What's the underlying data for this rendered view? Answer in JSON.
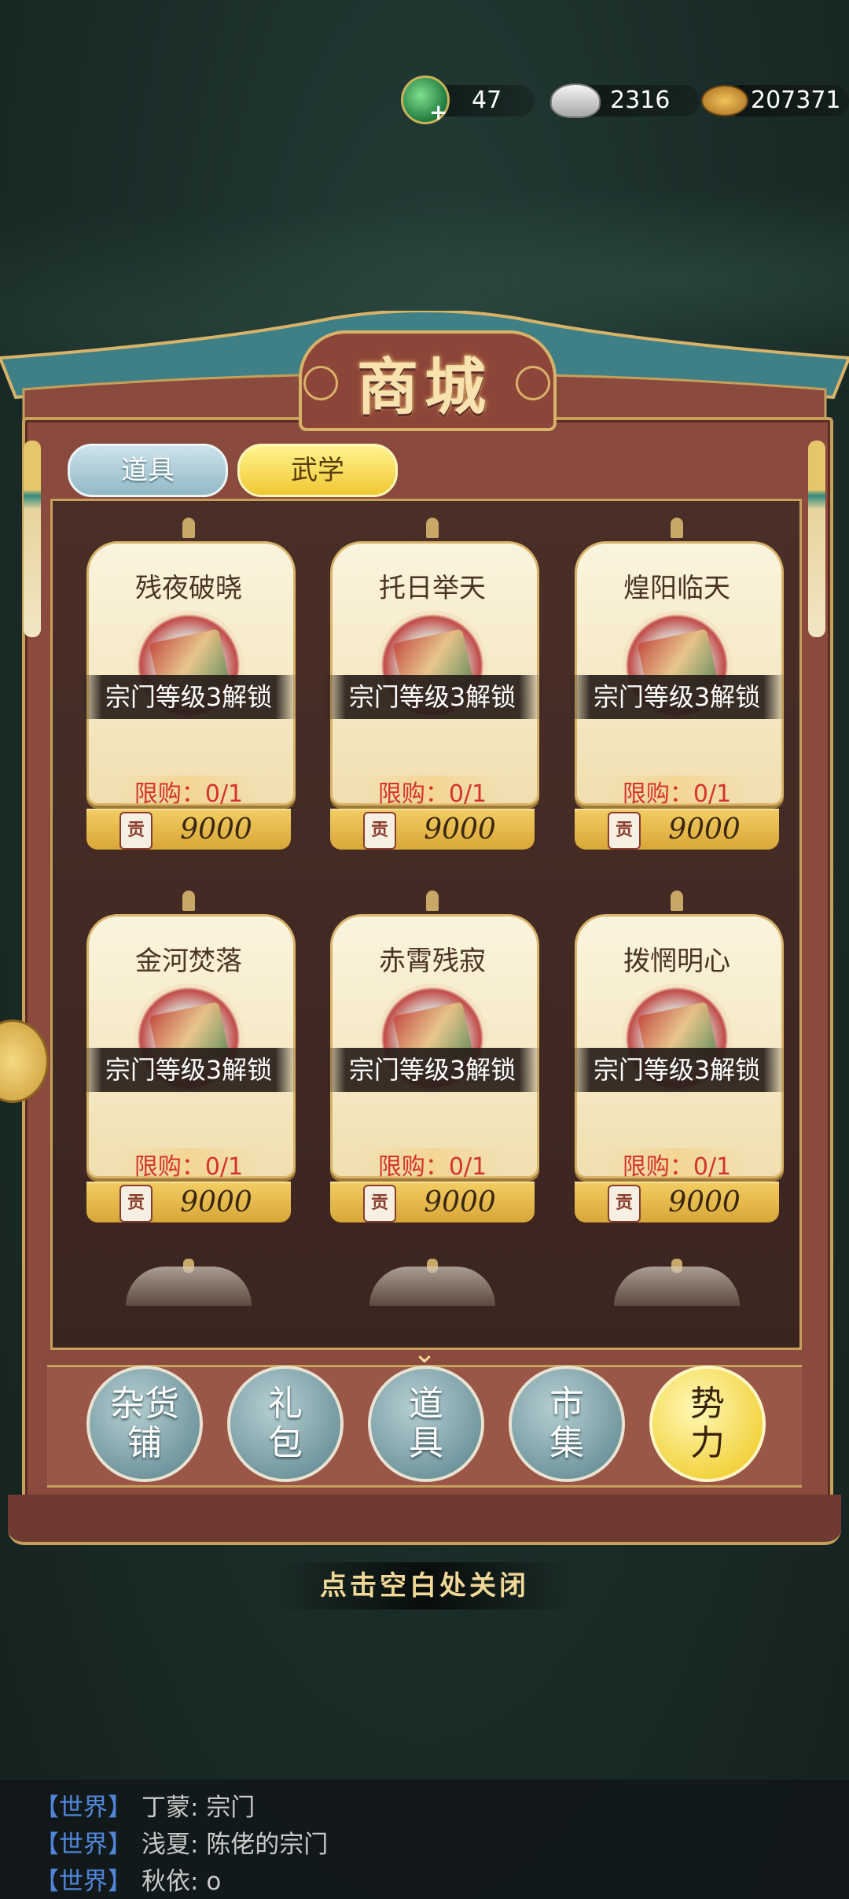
{
  "currency": {
    "jade": {
      "icon": "jade-dragon-icon",
      "value": "47"
    },
    "silver": {
      "icon": "silver-ingot-icon",
      "value": "2316"
    },
    "coins": {
      "icon": "copper-coins-icon",
      "value": "207371"
    }
  },
  "shop": {
    "title": "商城",
    "tabs": [
      {
        "label": "道具",
        "active": false
      },
      {
        "label": "武学",
        "active": true
      }
    ],
    "items": [
      {
        "name": "残夜破晓",
        "lock": "宗门等级3解锁",
        "limit": "限购：0/1",
        "badge": "贡",
        "price": "9000"
      },
      {
        "name": "托日举天",
        "lock": "宗门等级3解锁",
        "limit": "限购：0/1",
        "badge": "贡",
        "price": "9000"
      },
      {
        "name": "煌阳临天",
        "lock": "宗门等级3解锁",
        "limit": "限购：0/1",
        "badge": "贡",
        "price": "9000"
      },
      {
        "name": "金河焚落",
        "lock": "宗门等级3解锁",
        "limit": "限购：0/1",
        "badge": "贡",
        "price": "9000"
      },
      {
        "name": "赤霄残寂",
        "lock": "宗门等级3解锁",
        "limit": "限购：0/1",
        "badge": "贡",
        "price": "9000"
      },
      {
        "name": "拨惘明心",
        "lock": "宗门等级3解锁",
        "limit": "限购：0/1",
        "badge": "贡",
        "price": "9000"
      }
    ],
    "nav": [
      {
        "label_top": "杂货",
        "label_bottom": "铺",
        "active": false
      },
      {
        "label_top": "礼",
        "label_bottom": "包",
        "active": false
      },
      {
        "label_top": "道",
        "label_bottom": "具",
        "active": false
      },
      {
        "label_top": "市",
        "label_bottom": "集",
        "active": false
      },
      {
        "label_top": "势",
        "label_bottom": "力",
        "active": true
      }
    ],
    "close_hint": "点击空白处关闭"
  },
  "chat": [
    {
      "channel": "【世界】",
      "user": "丁蒙",
      "message": "宗门"
    },
    {
      "channel": "【世界】",
      "user": "浅夏",
      "message": "陈佬的宗门"
    },
    {
      "channel": "【世界】",
      "user": "秋依",
      "message": "o"
    }
  ]
}
